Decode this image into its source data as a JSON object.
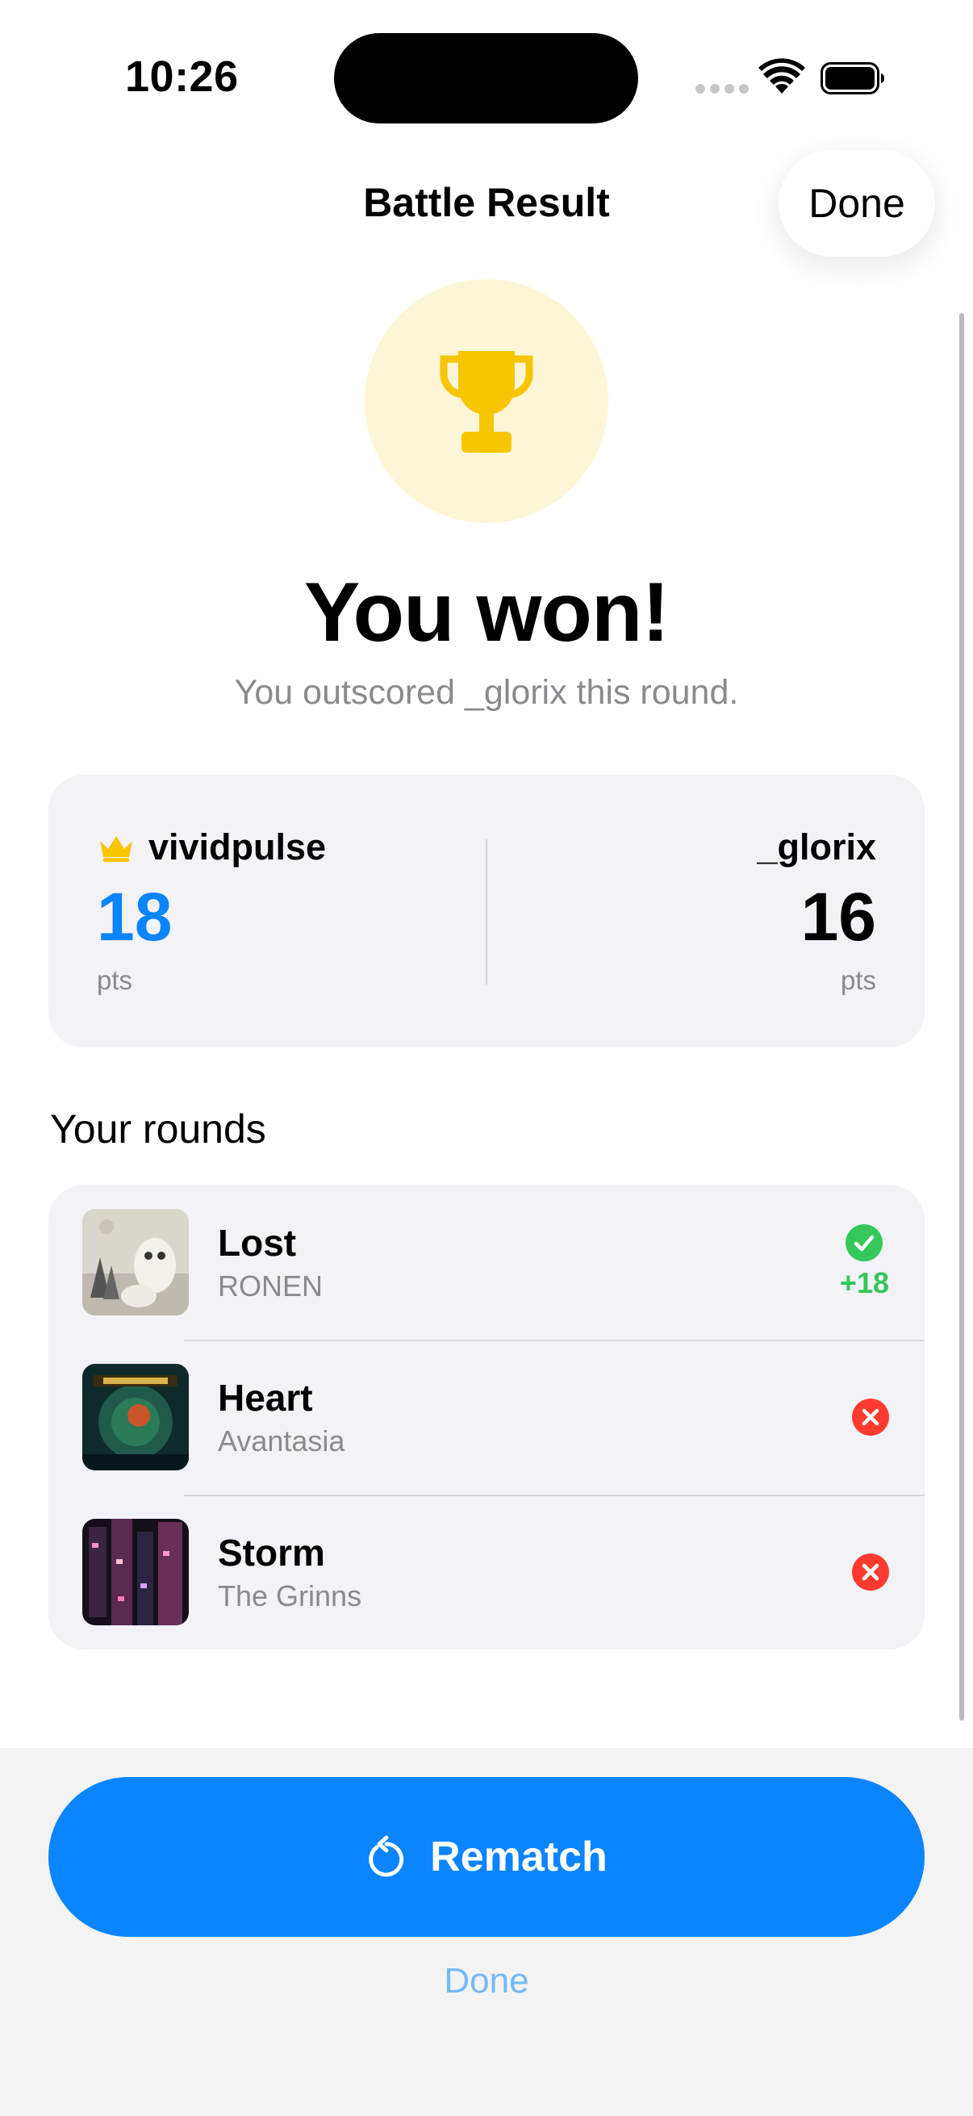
{
  "status_bar": {
    "time": "10:26"
  },
  "nav": {
    "title": "Battle Result",
    "done_label": "Done"
  },
  "result": {
    "headline": "You won!",
    "subline": "You outscored _glorix this round."
  },
  "score": {
    "player": {
      "name": "vividpulse",
      "points": "18",
      "unit": "pts"
    },
    "opponent": {
      "name": "_glorix",
      "points": "16",
      "unit": "pts"
    }
  },
  "rounds": {
    "title": "Your rounds",
    "items": [
      {
        "title": "Lost",
        "artist": "RONEN",
        "status": "correct",
        "points": "+18"
      },
      {
        "title": "Heart",
        "artist": "Avantasia",
        "status": "wrong"
      },
      {
        "title": "Storm",
        "artist": "The Grinns",
        "status": "wrong"
      }
    ]
  },
  "actions": {
    "rematch_label": "Rematch",
    "done_label": "Done"
  },
  "colors": {
    "accent": "#0a84ff",
    "gold": "#f7c600",
    "success": "#34c759",
    "error": "#ff3b30"
  },
  "icons": [
    "trophy-icon",
    "crown-icon",
    "checkmark-circle-icon",
    "xmark-circle-icon",
    "rematch-arrow-icon",
    "wifi-icon",
    "battery-icon"
  ]
}
